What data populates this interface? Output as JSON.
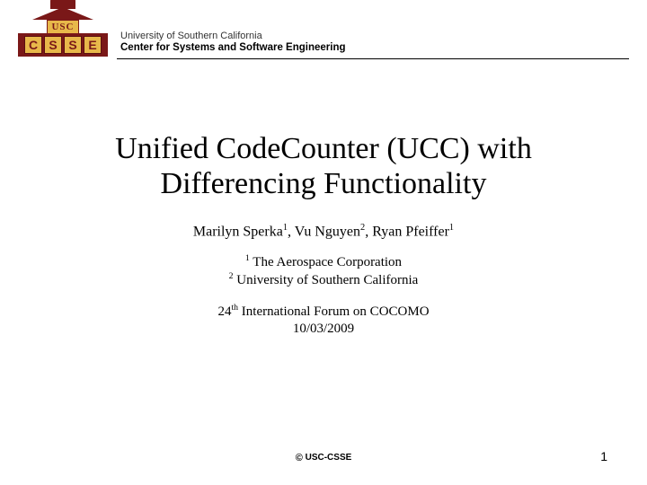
{
  "header": {
    "logo_usc": "USC",
    "logo_letters": [
      "C",
      "S",
      "S",
      "E"
    ],
    "university": "University of Southern California",
    "center": "Center for Systems and Software Engineering"
  },
  "title": {
    "line1": "Unified CodeCounter (UCC) with",
    "line2": "Differencing Functionality"
  },
  "authors": {
    "a1_name": "Marilyn Sperka",
    "a1_sup": "1",
    "sep1": ", ",
    "a2_name": "Vu Nguyen",
    "a2_sup": "2",
    "sep2": ", ",
    "a3_name": "Ryan Pfeiffer",
    "a3_sup": "1"
  },
  "affiliations": {
    "n1_sup": "1",
    "n1_text": " The Aerospace Corporation",
    "n2_sup": "2",
    "n2_text": " University of Southern California"
  },
  "venue": {
    "line1_pre": "24",
    "line1_sup": "th",
    "line1_post": " International Forum on COCOMO",
    "date": "10/03/2009"
  },
  "footer": {
    "copyright_symbol": "©",
    "copyright_text": " USC-CSSE",
    "page": "1"
  }
}
